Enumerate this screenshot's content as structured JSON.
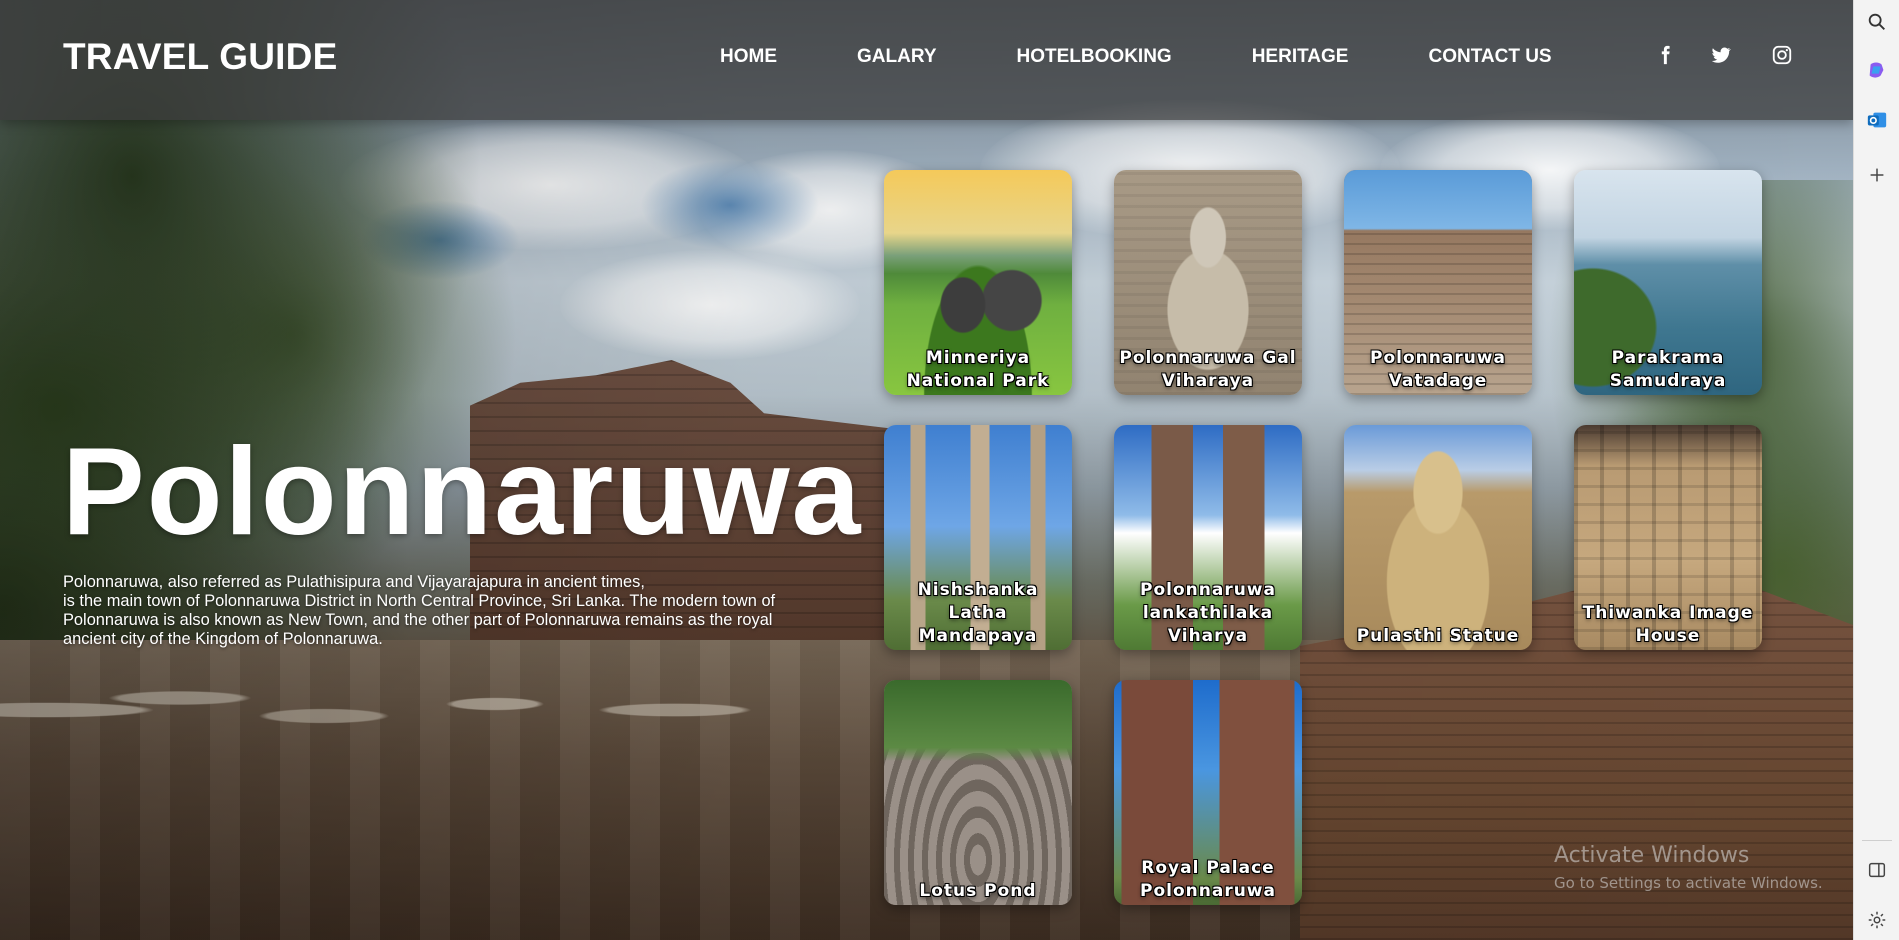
{
  "header": {
    "logo": "TRAVEL GUIDE",
    "nav": [
      {
        "label": "HOME"
      },
      {
        "label": "GALARY"
      },
      {
        "label": "HOTELBOOKING"
      },
      {
        "label": "HERITAGE"
      },
      {
        "label": "CONTACT US"
      }
    ],
    "social_icons": [
      "facebook-icon",
      "twitter-icon",
      "instagram-icon"
    ]
  },
  "hero": {
    "title": "Polonnaruwa",
    "description_lines": [
      "Polonnaruwa, also referred as Pulathisipura and Vijayarajapura in ancient times,",
      "is the main town of Polonnaruwa District in North Central Province, Sri Lanka. The modern town of",
      "Polonnaruwa is also known as New Town, and the other part of Polonnaruwa remains as the royal",
      "ancient city of the Kingdom of Polonnaruwa."
    ]
  },
  "cards": [
    {
      "label": "Minneriya National Park"
    },
    {
      "label": "Polonnaruwa Gal Viharaya"
    },
    {
      "label": "Polonnaruwa Vatadage"
    },
    {
      "label": "Parakrama Samudraya"
    },
    {
      "label": "Nishshanka Latha Mandapaya"
    },
    {
      "label": "Polonnaruwa lankathilaka Viharya"
    },
    {
      "label": "Pulasthi Statue"
    },
    {
      "label": "Thiwanka Image House"
    },
    {
      "label": "Lotus Pond"
    },
    {
      "label": "Royal Palace Polonnaruwa"
    }
  ],
  "watermark": {
    "title": "Activate Windows",
    "subtitle": "Go to Settings to activate Windows."
  },
  "edge_sidebar": {
    "icons": [
      "search-icon",
      "copilot-icon",
      "outlook-icon",
      "add-icon",
      "sidebar-toggle-icon",
      "settings-icon"
    ],
    "accent": "#0f6cbd"
  }
}
